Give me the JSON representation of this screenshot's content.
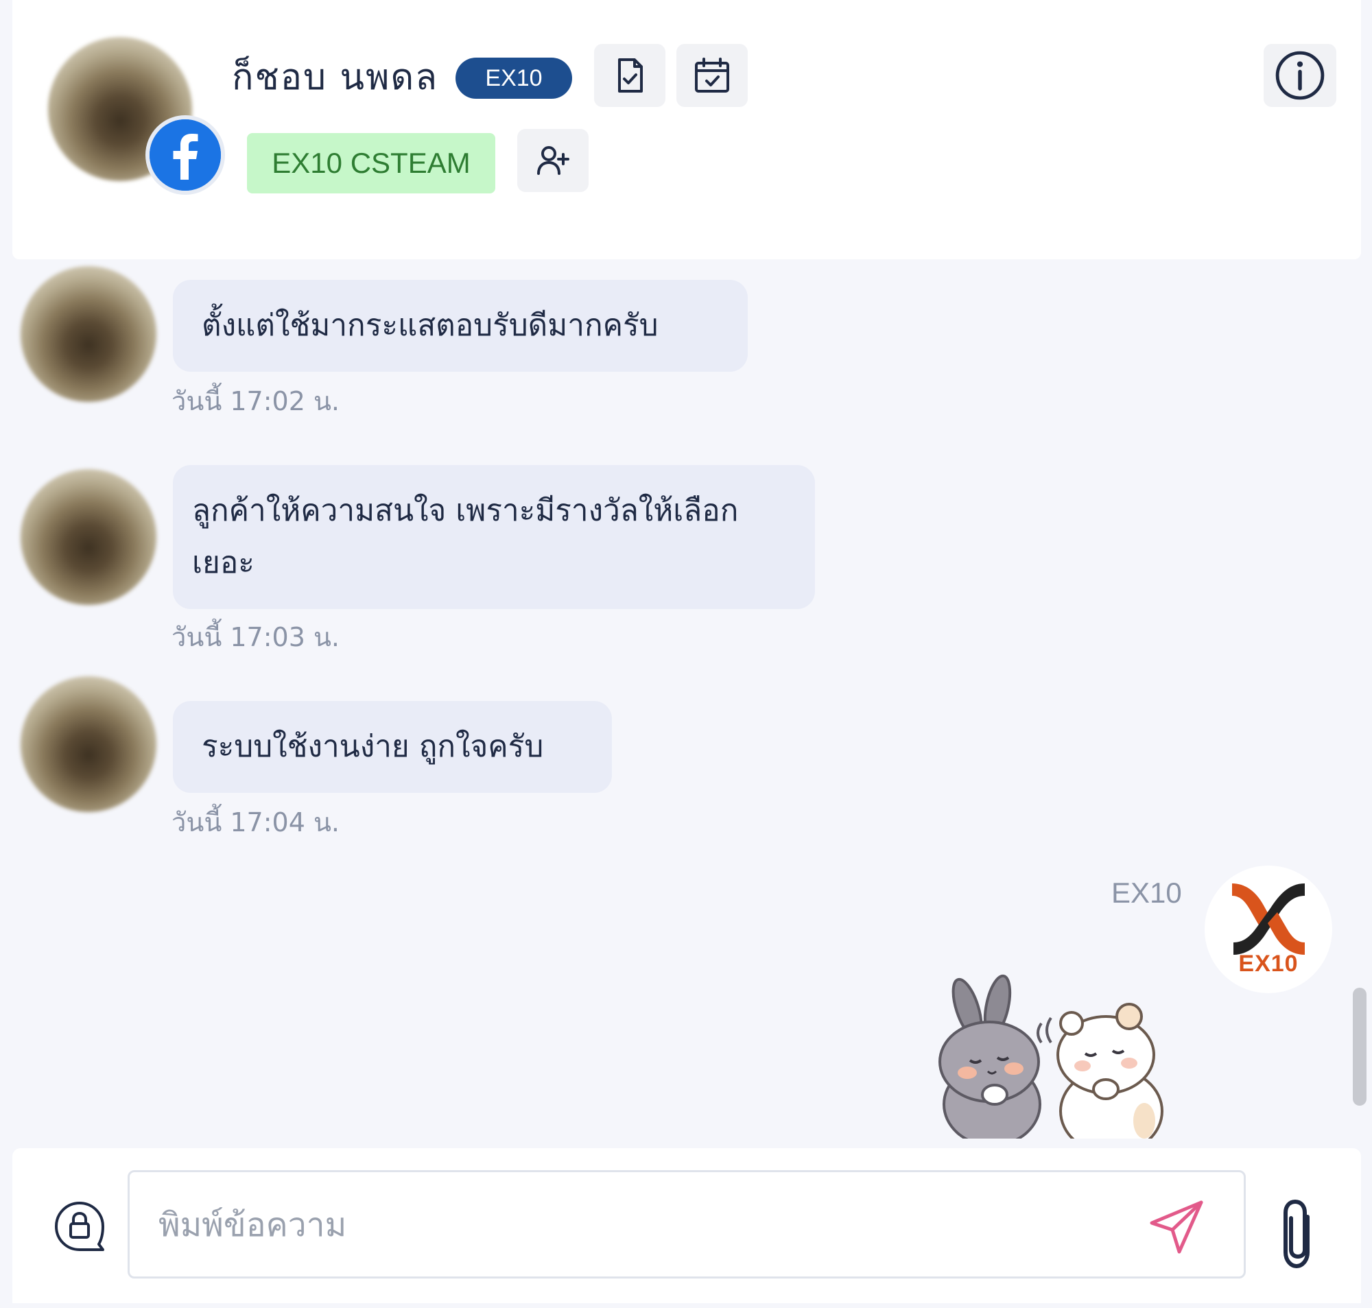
{
  "header": {
    "contact_name": "ก็ชอบ นพดล",
    "channel_label": "EX10",
    "team_tag": "EX10 CSTEAM",
    "icons": [
      "file-check-icon",
      "calendar-check-icon",
      "info-icon",
      "add-user-icon",
      "facebook-icon"
    ]
  },
  "messages": [
    {
      "text": "ตั้งแต่ใช้มากระแสตอบรับดีมากครับ",
      "time": "วันนี้ 17:02 น."
    },
    {
      "text": " ลูกค้าให้ความสนใจ เพราะมีรางวัลให้เลือกเยอะ",
      "time": "วันนี้ 17:03 น."
    },
    {
      "text": "ระบบใช้งานง่าย ถูกใจครับ",
      "time": "วันนี้ 17:04 น."
    }
  ],
  "outgoing": {
    "sender": "EX10",
    "brand_logo_text": "EX10",
    "sticker": "bunny-and-bear-sticker"
  },
  "composer": {
    "placeholder": "พิมพ์ข้อความ",
    "value": "",
    "icons": [
      "lock-chat-icon",
      "send-icon",
      "paperclip-icon"
    ]
  },
  "colors": {
    "channel_pill": "#1d4e8f",
    "team_tag_bg": "#c6f7c9",
    "team_tag_text": "#2e7d32",
    "bubble_bg": "#e9ecf7",
    "send_icon": "#e25a8a",
    "brand_orange": "#d9541c",
    "facebook_blue": "#1b74e4"
  }
}
